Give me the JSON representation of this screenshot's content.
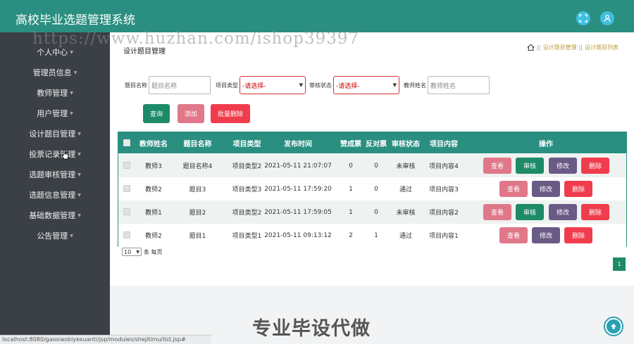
{
  "header": {
    "title": "高校毕业选题管理系统",
    "fullscreen_icon": "expand-icon",
    "user_icon": "user-icon",
    "accent": "#2a8f80"
  },
  "watermark": "https://www.huzhan.com/ishop39397",
  "sidebar": {
    "items": [
      {
        "label": "个人中心"
      },
      {
        "label": "管理员信息"
      },
      {
        "label": "教师管理"
      },
      {
        "label": "用户管理"
      },
      {
        "label": "设计题目管理"
      },
      {
        "label": "投票记录管理"
      },
      {
        "label": "选题审核管理"
      },
      {
        "label": "选题信息管理"
      },
      {
        "label": "基础数据管理"
      },
      {
        "label": "公告管理"
      }
    ]
  },
  "main": {
    "page_title": "设计题目管理",
    "breadcrumb": {
      "sep": "||",
      "item1": "设计题目管理",
      "item2": "设计题目列表"
    },
    "filters": {
      "title_label": "题目名称",
      "title_placeholder": "题目名称",
      "type_label": "项目类型",
      "type_value": "-请选择-",
      "status_label": "审核状态",
      "status_value": "-请选择-",
      "teacher_label": "教师姓名",
      "teacher_placeholder": "教师姓名"
    },
    "buttons": {
      "search": "查询",
      "add": "添加",
      "batch_delete": "批量删除"
    },
    "table": {
      "headers": [
        "教师姓名",
        "题目名称",
        "项目类型",
        "发布时间",
        "赞成票",
        "反对票",
        "审核状态",
        "项目内容",
        "操作"
      ],
      "rows": [
        {
          "teacher": "教师3",
          "title": "题目名称4",
          "type": "项目类型2",
          "time": "2021-05-11 21:07:07",
          "yes": "0",
          "no": "0",
          "status": "未审核",
          "content": "项目内容4",
          "actions": [
            "查看",
            "审核",
            "修改",
            "删除"
          ]
        },
        {
          "teacher": "教师2",
          "title": "题目3",
          "type": "项目类型3",
          "time": "2021-05-11 17:59:20",
          "yes": "1",
          "no": "0",
          "status": "通过",
          "content": "项目内容3",
          "actions": [
            "查看",
            "修改",
            "删除"
          ]
        },
        {
          "teacher": "教师1",
          "title": "题目2",
          "type": "项目类型2",
          "time": "2021-05-11 17:59:05",
          "yes": "1",
          "no": "0",
          "status": "未审核",
          "content": "项目内容2",
          "actions": [
            "查看",
            "审核",
            "修改",
            "删除"
          ]
        },
        {
          "teacher": "教师2",
          "title": "题目1",
          "type": "项目类型1",
          "time": "2021-05-11 09:13:12",
          "yes": "2",
          "no": "1",
          "status": "通过",
          "content": "项目内容1",
          "actions": [
            "查看",
            "修改",
            "删除"
          ]
        }
      ]
    },
    "pager": {
      "page_size": "10",
      "suffix": "条 每页",
      "current_page": "1"
    }
  },
  "status_url": "localhost:8080/gaoxiaobiyexuanti/jsp/modules/shejitimu/list.jsp#",
  "promo": "专业毕设代做"
}
